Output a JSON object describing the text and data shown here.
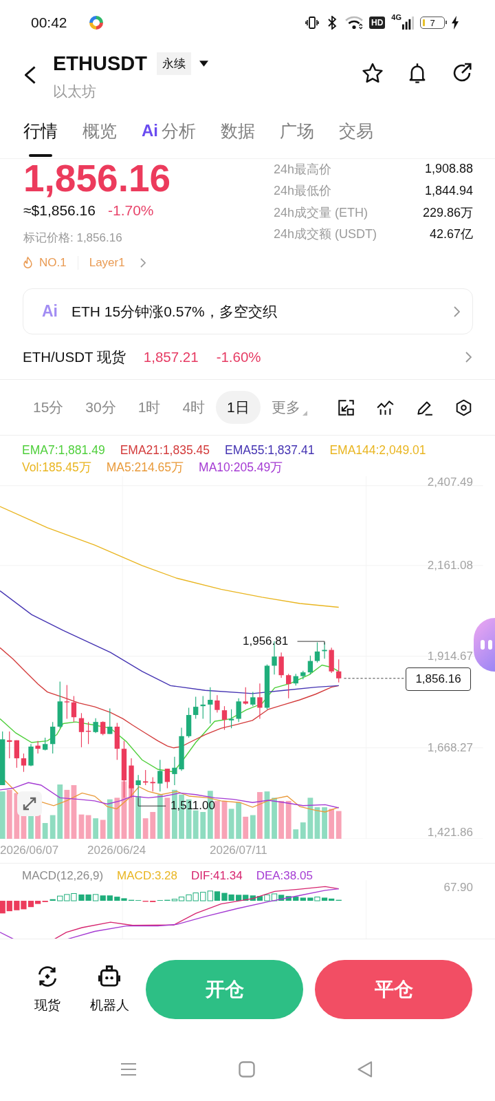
{
  "status_bar": {
    "time": "00:42",
    "hd": "HD",
    "network": "4G",
    "battery": "7"
  },
  "header": {
    "symbol": "ETHUSDT",
    "contract_type": "永续",
    "name": "以太坊"
  },
  "tabs": [
    {
      "label": "行情",
      "selected": true,
      "kind": "plain"
    },
    {
      "label": "概览",
      "selected": false,
      "kind": "plain"
    },
    {
      "label": "分析",
      "selected": false,
      "kind": "ai",
      "prefix": "Ai"
    },
    {
      "label": "数据",
      "selected": false,
      "kind": "plain"
    },
    {
      "label": "广场",
      "selected": false,
      "kind": "plain"
    },
    {
      "label": "交易",
      "selected": false,
      "kind": "plain"
    }
  ],
  "price": {
    "last": "1,856.16",
    "approx": "≈$1,856.16",
    "change": "-1.70%",
    "mark_price": "标记价格: 1,856.16"
  },
  "stats": [
    {
      "label": "24h最高价",
      "value": "1,908.88"
    },
    {
      "label": "24h最低价",
      "value": "1,844.94"
    },
    {
      "label": "24h成交量 (ETH)",
      "value": "229.86万"
    },
    {
      "label": "24h成交额 (USDT)",
      "value": "42.67亿"
    }
  ],
  "tags": [
    {
      "kind": "rank",
      "label": "NO.1"
    },
    {
      "kind": "sector",
      "label": "Layer1"
    }
  ],
  "ai_summary": {
    "badge": "Ai",
    "text": "ETH 15分钟涨0.57%，多空交织"
  },
  "spot": {
    "label": "ETH/USDT 现货",
    "price": "1,857.21",
    "change": "-1.60%"
  },
  "timeframes": [
    {
      "label": "15分",
      "selected": false
    },
    {
      "label": "30分",
      "selected": false
    },
    {
      "label": "1时",
      "selected": false
    },
    {
      "label": "4时",
      "selected": false
    },
    {
      "label": "1日",
      "selected": true
    }
  ],
  "more": {
    "label": "更多"
  },
  "chart": {
    "legend": [
      {
        "label": "EMA7:1,881.49",
        "color": "#4fcf3b"
      },
      {
        "label": "EMA21:1,835.45",
        "color": "#d33b3b"
      },
      {
        "label": "EMA55:1,837.41",
        "color": "#4433b2"
      },
      {
        "label": "EMA144:2,049.01",
        "color": "#e9b520"
      }
    ],
    "volume_legend": [
      {
        "label": "Vol:185.45万",
        "color": "#e9b520"
      },
      {
        "label": "MA5:214.65万",
        "color": "#e99a3a"
      },
      {
        "label": "MA10:205.49万",
        "color": "#a43ad3"
      }
    ],
    "y_labels": [
      "2,407.49",
      "2,161.08",
      "1,914.67",
      "1,668.27",
      "1,421.86"
    ],
    "high_label": "1,956.81",
    "low_label": "1,511.00",
    "last_price": "1,856.16",
    "x_labels": [
      "2026/06/07",
      "2026/06/24",
      "2026/07/11"
    ]
  },
  "macd": {
    "title": "MACD(12,26,9)",
    "legend": [
      {
        "label": "MACD:3.28",
        "color": "#e9b520"
      },
      {
        "label": "DIF:41.34",
        "color": "#d6246e"
      },
      {
        "label": "DEA:38.05",
        "color": "#a43ad3"
      }
    ],
    "y_label": "67.90"
  },
  "actions": [
    {
      "kind": "spot",
      "label": "现货"
    },
    {
      "kind": "robot",
      "label": "机器人"
    }
  ],
  "buttons": [
    {
      "kind": "open",
      "label": "开仓"
    },
    {
      "kind": "close",
      "label": "平仓"
    }
  ]
}
